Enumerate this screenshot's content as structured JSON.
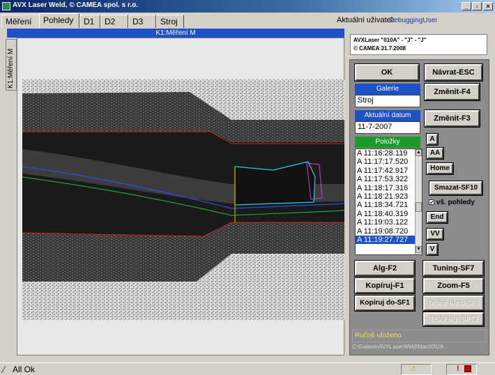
{
  "window": {
    "title": "AVX Laser Weld, © CAMEA spol. s r.o.",
    "min_glyph": "_",
    "max_glyph": "▫",
    "close_glyph": "×"
  },
  "tabs": [
    {
      "label": "Měření",
      "active": false
    },
    {
      "label": "Pohledy",
      "active": true
    },
    {
      "label": "D1",
      "active": false
    },
    {
      "label": "D2",
      "active": false
    },
    {
      "label": "D3",
      "active": false
    },
    {
      "label": "Stroj",
      "active": false
    }
  ],
  "user": {
    "label": "Aktuální uživatel:",
    "value": "DebuggingUser"
  },
  "view": {
    "title": "K1:Měření M",
    "side_tab": "K1:Měření M"
  },
  "info": {
    "line1": "AVXLaser  \"010A\" - \"J\" - \"J\"",
    "line2": "© CAMEA      31.7.2008"
  },
  "panel": {
    "ok": "OK",
    "back": "Návrat-ESC",
    "gallery_header": "Galerie",
    "gallery_value": "Stroj",
    "change_f4": "Změnit-F4",
    "date_header": "Aktuální datum",
    "date_value": "11-7-2007",
    "change_f3": "Změnit-F3",
    "items_header": "Položky",
    "items": [
      "A 11:16:28.119",
      "A 11:17:17.520",
      "A 11:17:42.917",
      "A 11:17:53.322",
      "A 11:18:17.316",
      "A 11:18:21.923",
      "A 11:18:34.721",
      "A 11:18:40.319",
      "A 11:19:03.122",
      "A 11:19:08.720",
      "A 11:19:27.727"
    ],
    "selected_index": 10,
    "btn_a": "A",
    "btn_aa": "AA",
    "btn_home": "Home",
    "btn_delete": "Smazat-SF10",
    "checkbox_label": "vš. pohledy",
    "checkbox_checked": true,
    "btn_end": "End",
    "btn_vv": "VV",
    "btn_v": "V",
    "btn_alg": "Alg-F2",
    "btn_tuning": "Tuning-SF7",
    "btn_copy": "Kopíruj-F1",
    "btn_zoom": "Zoom-F5",
    "btn_copy_to": "Kopíruj do-SF1",
    "btn_second_window": "Druhé okno-SF6",
    "btn_tests": "Testy alg.-SF12",
    "status": "Ručně uloženo",
    "path": "C:\\Galerie\\AVXLaserWeld\\Mach0\\UA"
  },
  "statusbar": {
    "text": "All Ok",
    "warn_glyph": "⚠",
    "alert_glyph": "!"
  },
  "colors": {
    "title_blue": "#0a246a",
    "header_blue": "#1e50c8",
    "header_green": "#1a9a2a",
    "panel_gray": "#8c8c8c",
    "status_yellow": "#f0e060"
  }
}
